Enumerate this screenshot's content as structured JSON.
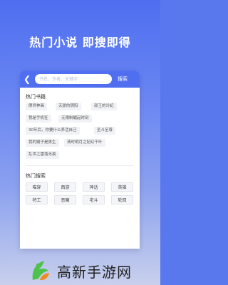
{
  "headline": "热门小说 即搜即得",
  "search": {
    "placeholder": "书名、作者、关键字",
    "button_label": "搜索"
  },
  "hot_books": {
    "title": "热门书籍",
    "items": [
      "摩师神画",
      "天骄的阴阳",
      "邪王的冷妃",
      "我是手机狂",
      "无限制崛起时刻",
      "30年后，你要什么养活自己",
      "圣斗至尊",
      "我的嫂子是男生",
      "清时明月之妃幻千叶",
      "乱世之雷落无痕"
    ]
  },
  "hot_search": {
    "title": "热门搜索",
    "items": [
      "喵穿",
      "西游",
      "神话",
      "英雄",
      "特工",
      "恶魔",
      "宅斗",
      "轮回"
    ]
  },
  "brand": {
    "name": "高新手游网",
    "logo_icon": "green-leaf-logo-icon",
    "colors": {
      "green": "#4ec24a",
      "orange": "#f08a1c"
    }
  },
  "colors": {
    "accent": "#4f6ff0"
  }
}
